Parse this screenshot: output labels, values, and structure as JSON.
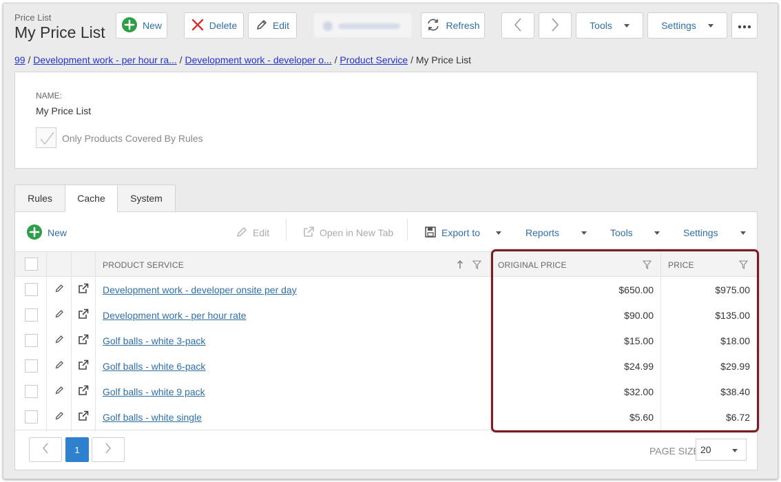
{
  "header": {
    "subtitle": "Price List",
    "title": "My Price List"
  },
  "toolbar": {
    "new_label": "New",
    "delete_label": "Delete",
    "edit_label": "Edit",
    "refresh_label": "Refresh",
    "tools_label": "Tools",
    "settings_label": "Settings"
  },
  "breadcrumb": {
    "items": [
      "99",
      "Development work - per hour ra...",
      "Development work - developer o...",
      "Product Service"
    ],
    "current": "My Price List"
  },
  "form": {
    "name_label": "NAME:",
    "name_value": "My Price List",
    "only_products_label": "Only Products Covered By Rules",
    "only_products_checked": true
  },
  "tabs": [
    {
      "label": "Rules"
    },
    {
      "label": "Cache"
    },
    {
      "label": "System"
    }
  ],
  "active_tab": "Cache",
  "grid_toolbar": {
    "new_label": "New",
    "edit_label": "Edit",
    "open_new_tab_label": "Open in New Tab",
    "export_label": "Export to",
    "reports_label": "Reports",
    "tools_label": "Tools",
    "settings_label": "Settings"
  },
  "table": {
    "columns": [
      "PRODUCT SERVICE",
      "ORIGINAL PRICE",
      "PRICE"
    ],
    "rows": [
      {
        "product": "Development work - developer onsite per day",
        "original_price": "$650.00",
        "price": "$975.00"
      },
      {
        "product": "Development work - per hour rate",
        "original_price": "$90.00",
        "price": "$135.00"
      },
      {
        "product": "Golf balls - white 3-pack",
        "original_price": "$15.00",
        "price": "$18.00"
      },
      {
        "product": "Golf balls - white 6-pack",
        "original_price": "$24.99",
        "price": "$29.99"
      },
      {
        "product": "Golf balls - white 9 pack",
        "original_price": "$32.00",
        "price": "$38.40"
      },
      {
        "product": "Golf balls - white single",
        "original_price": "$5.60",
        "price": "$6.72"
      }
    ]
  },
  "pagination": {
    "current_page": "1",
    "page_size_label": "PAGE SIZE",
    "page_size": "20"
  },
  "colors": {
    "accent_blue": "#2f6fa7",
    "new_green": "#2e9e48",
    "delete_red": "#d9302c",
    "highlight_border": "#7a1c22",
    "current_page": "#2f80ce"
  }
}
